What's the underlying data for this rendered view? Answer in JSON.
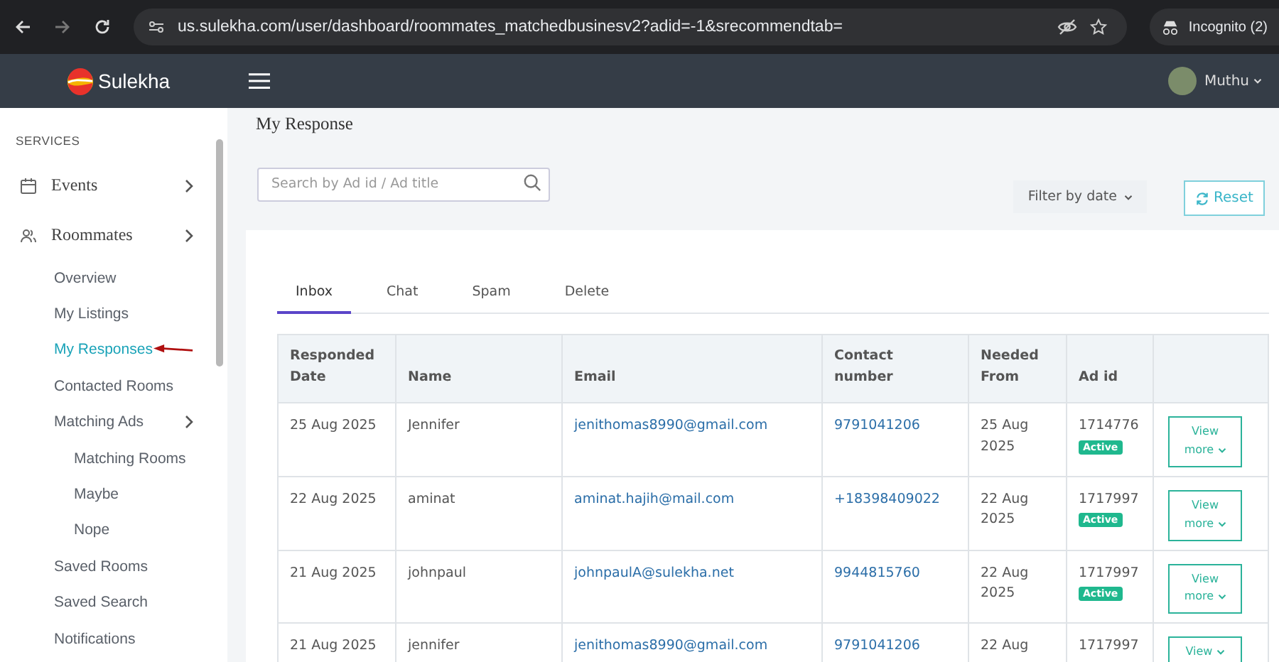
{
  "browser": {
    "url": "us.sulekha.com/user/dashboard/roommates_matchedbusinesv2?adid=-1&srecommendtab=",
    "profile": "Incognito (2)"
  },
  "header": {
    "logo": "Sulekha",
    "user": "Muthu"
  },
  "sidebar": {
    "section": "SERVICES",
    "items": [
      {
        "label": "Events",
        "kind": "calendar",
        "chevron": true,
        "selected": false
      },
      {
        "label": "Roommates",
        "kind": "people",
        "chevron": true,
        "selected": false,
        "children": [
          {
            "label": "Overview",
            "selected": false
          },
          {
            "label": "My Listings",
            "selected": false
          },
          {
            "label": "My Responses",
            "selected": true,
            "annotated": true
          },
          {
            "label": "Contacted Rooms",
            "selected": false
          },
          {
            "label": "Matching Ads",
            "chevron": true,
            "selected": false,
            "children": [
              {
                "label": "Matching Rooms",
                "selected": false
              },
              {
                "label": "Maybe",
                "selected": false
              },
              {
                "label": "Nope",
                "selected": false
              }
            ]
          },
          {
            "label": "Saved Rooms",
            "selected": false
          },
          {
            "label": "Saved Search",
            "selected": false
          },
          {
            "label": "Notifications",
            "selected": false
          }
        ]
      }
    ]
  },
  "main": {
    "title": "My Response",
    "search": {
      "placeholder": "Search by Ad id / Ad title"
    },
    "filter": "Filter by date",
    "reset": "Reset",
    "tabs": [
      {
        "label": "Inbox",
        "selected": true
      },
      {
        "label": "Chat",
        "selected": false
      },
      {
        "label": "Spam",
        "selected": false
      },
      {
        "label": "Delete",
        "selected": false
      }
    ],
    "table": {
      "columns": [
        "Responded Date",
        "Name",
        "Email",
        "Contact number",
        "Needed From",
        "Ad id"
      ],
      "rows": [
        {
          "date": "25 Aug 2025",
          "name": "Jennifer",
          "email": "jenithomas8990@gmail.com",
          "phone": "9791041206",
          "needed": "25 Aug 2025",
          "ad_id": "1714776",
          "status": "Active",
          "action": "View more"
        },
        {
          "date": "22 Aug 2025",
          "name": "aminat",
          "email": "aminat.hajih@mail.com",
          "phone": "+18398409022",
          "needed": "22 Aug 2025",
          "ad_id": "1717997",
          "status": "Active",
          "action": "View more"
        },
        {
          "date": "21 Aug 2025",
          "name": "johnpaul",
          "email": "johnpaulA@sulekha.net",
          "phone": "9944815760",
          "needed": "22 Aug 2025",
          "ad_id": "1717997",
          "status": "Active",
          "action": "View more"
        },
        {
          "date": "21 Aug 2025",
          "name": "jennifer",
          "email": "jenithomas8990@gmail.com",
          "phone": "9791041206",
          "needed": "22 Aug",
          "ad_id": "1717997",
          "action": "View"
        }
      ]
    }
  }
}
